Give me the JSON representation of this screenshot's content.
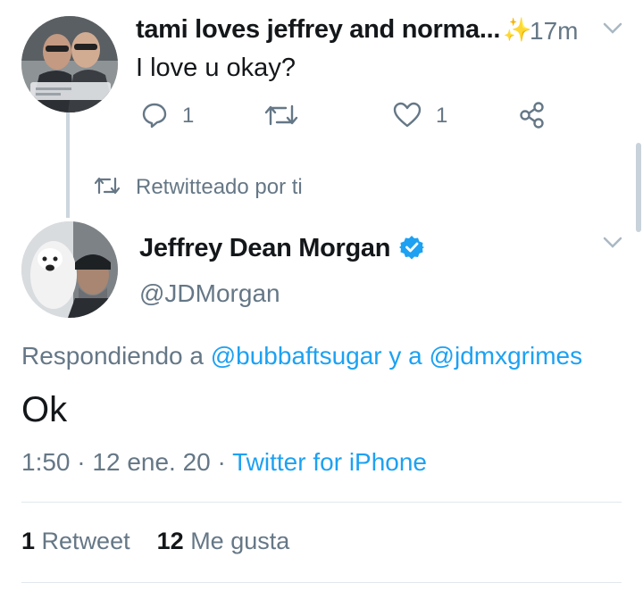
{
  "previous_tweet": {
    "display_name": "tami loves jeffrey and norma...",
    "time": "17m",
    "text": "I love u okay?",
    "reply_count": "1",
    "like_count": "1"
  },
  "retweet_label": "Retwitteado por ti",
  "main_tweet": {
    "display_name": "Jeffrey Dean Morgan",
    "handle": "@JDMorgan",
    "replying_prefix": "Respondiendo a",
    "reply_to_1": "@bubbaftsugar",
    "reply_joiner": "y a",
    "reply_to_2": "@jdmxgrimes",
    "text": "Ok",
    "time": "1:50",
    "date": "12 ene. 20",
    "source": "Twitter for iPhone",
    "separator": "·"
  },
  "stats": {
    "retweets_count": "1",
    "retweets_label": "Retweet",
    "likes_count": "12",
    "likes_label": "Me gusta"
  },
  "colors": {
    "link_blue": "#1da1f2",
    "secondary_gray": "#657786",
    "sparkle": "#f5b300"
  },
  "icons": {
    "sparkle": "✨",
    "reply": "reply-icon",
    "retweet": "retweet-icon",
    "like": "heart-icon",
    "share": "share-icon",
    "verified": "verified-badge-icon"
  }
}
